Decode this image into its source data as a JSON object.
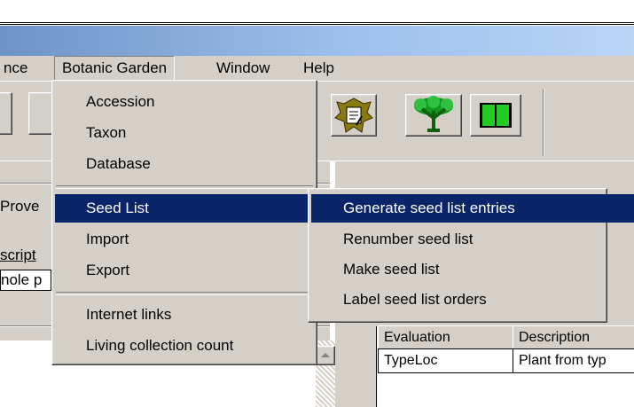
{
  "menubar": {
    "items": [
      "nce",
      "Botanic Garden",
      "Window",
      "Help"
    ]
  },
  "botanic_menu": {
    "items": [
      {
        "label": "Accession"
      },
      {
        "label": "Taxon"
      },
      {
        "label": "Database"
      },
      {
        "label": "Seed List",
        "submenu": true
      },
      {
        "label": "Import",
        "submenu": true
      },
      {
        "label": "Export",
        "submenu": true
      },
      {
        "label": "Internet links"
      },
      {
        "label": "Living collection count"
      }
    ]
  },
  "seed_submenu": {
    "items": [
      {
        "label": "Generate seed list entries"
      },
      {
        "label": "Renumber seed list"
      },
      {
        "label": "Make seed list"
      },
      {
        "label": "Label seed list orders"
      }
    ]
  },
  "left_panel": {
    "tab_label": "Prove",
    "field_label": "script",
    "field_value": "nole p"
  },
  "grid": {
    "headers": [
      "Evaluation",
      "Description"
    ],
    "rows": [
      [
        "TypeLoc",
        "Plant from typ"
      ]
    ]
  },
  "colors": {
    "titlebar": "#a6c8ee",
    "selection": "#0a246a",
    "face": "#d4d0c8"
  },
  "icons": [
    "leaf-document-icon",
    "tree-icon",
    "book-icon"
  ]
}
